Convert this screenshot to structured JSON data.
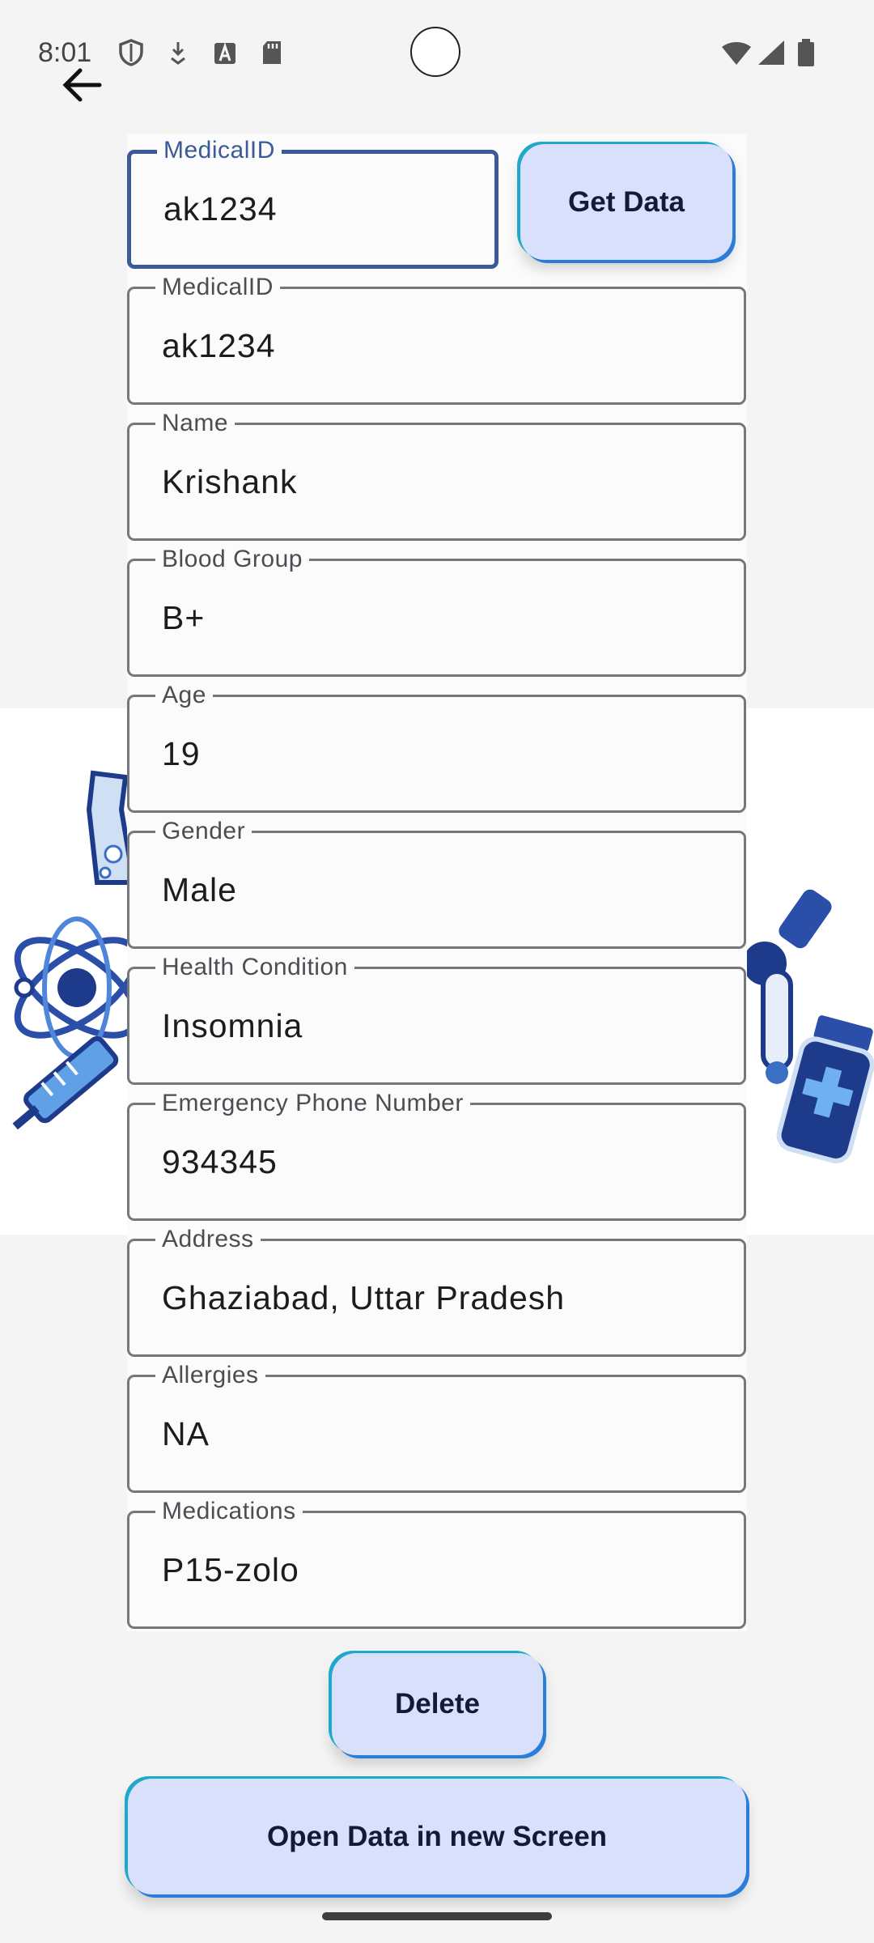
{
  "status_bar": {
    "time": "8:01"
  },
  "search": {
    "label": "MedicalID",
    "value": "ak1234",
    "button": "Get Data"
  },
  "fields": [
    {
      "label": "MedicalID",
      "value": "ak1234"
    },
    {
      "label": "Name",
      "value": "Krishank"
    },
    {
      "label": "Blood Group",
      "value": "B+"
    },
    {
      "label": "Age",
      "value": "19"
    },
    {
      "label": "Gender",
      "value": "Male"
    },
    {
      "label": "Health Condition",
      "value": "Insomnia"
    },
    {
      "label": "Emergency Phone Number",
      "value": "934345"
    },
    {
      "label": "Address",
      "value": "Ghaziabad, Uttar Pradesh"
    },
    {
      "label": "Allergies",
      "value": "NA"
    },
    {
      "label": "Medications",
      "value": "P15-zolo"
    }
  ],
  "actions": {
    "delete": "Delete",
    "open_new": "Open Data in new Screen"
  },
  "colors": {
    "button_bg": "#d9e0fb",
    "focus_border": "#3a5a98",
    "accent_teal": "#1fa8c9",
    "accent_blue": "#2a7dd8"
  }
}
